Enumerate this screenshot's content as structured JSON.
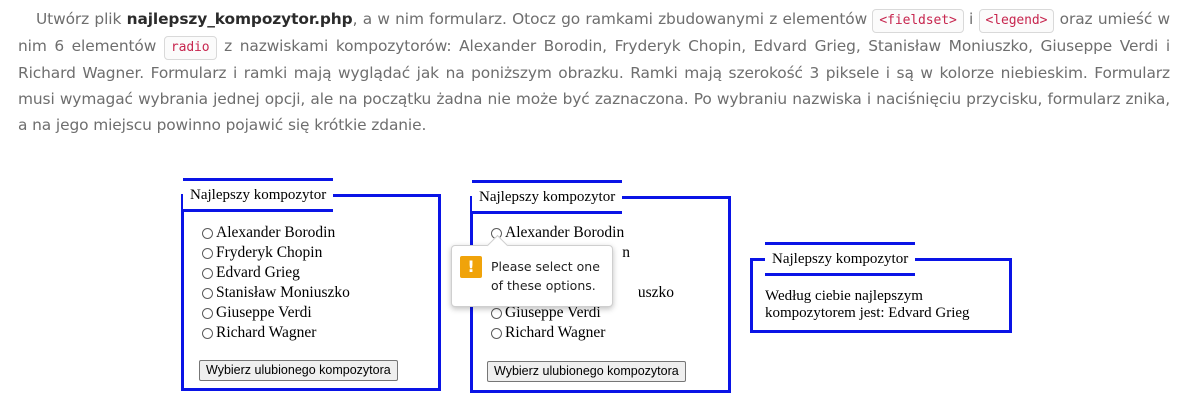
{
  "instructions": {
    "p1": "Utwórz plik ",
    "filename": "najlepszy_kompozytor.php",
    "p2": ", a w nim formularz. Otocz go ramkami zbudowanymi z elementów ",
    "code_fieldset": "<fieldset>",
    "p3": " i ",
    "code_legend": "<legend>",
    "p4": " oraz umieść w nim 6 elementów ",
    "code_radio": "radio",
    "p5": " z nazwiskami kompozytorów: Alexander Borodin, Fryderyk Chopin, Edvard Grieg, Stanisław Moniuszko, Giuseppe Verdi i Richard Wagner. Formularz i ramki mają wyglądać jak na poniższym obrazku. Ramki mają szerokość 3 piksele i są w kolorze niebieskim. Formularz musi wymagać wybrania jednej opcji, ale na początku żadna nie może być zaznaczona. Po wybraniu nazwiska i naciśnięciu przycisku, formularz znika, a na jego miejscu powinno pojawić się krótkie zdanie."
  },
  "form": {
    "legend": "Najlepszy kompozytor",
    "options": [
      "Alexander Borodin",
      "Fryderyk Chopin",
      "Edvard Grieg",
      "Stanisław Moniuszko",
      "Giuseppe Verdi",
      "Richard Wagner"
    ],
    "submit_label": "Wybierz ulubionego kompozytora"
  },
  "form_invalid": {
    "legend": "Najlepszy kompozytor",
    "options_visible": [
      "Alexander Borodin",
      "n",
      "uszko",
      "Giuseppe Verdi",
      "Richard Wagner"
    ],
    "submit_label": "Wybierz ulubionego kompozytora",
    "tooltip": "Please select one of these options."
  },
  "result": {
    "legend": "Najlepszy kompozytor",
    "text": "Według ciebie najlepszym kompozytorem jest: Edvard Grieg"
  },
  "colors": {
    "frame": "#0a14e6",
    "code_text": "#c7254e",
    "warning": "#f0a30a"
  },
  "icons": {
    "warning": "exclamation-warning-icon"
  }
}
